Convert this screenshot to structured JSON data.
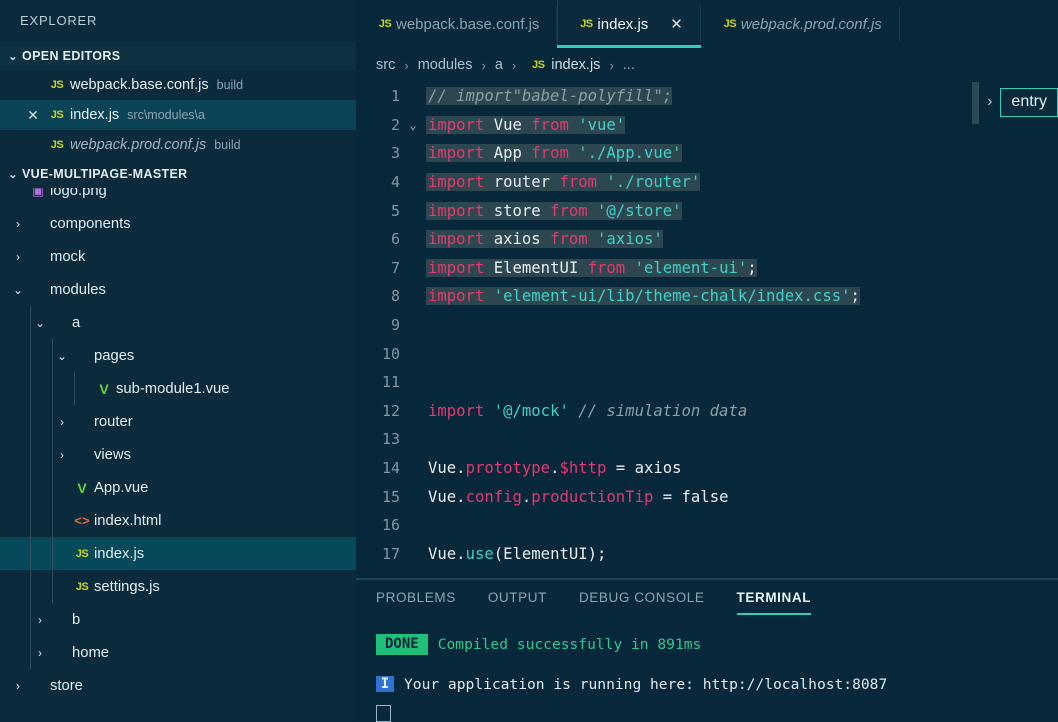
{
  "sidebar": {
    "title": "EXPLORER",
    "open_editors": {
      "label": "OPEN EDITORS",
      "twisty": "⌄",
      "items": [
        {
          "close": "",
          "icon": "js-icon",
          "icon_text": "JS",
          "name": "webpack.base.conf.js",
          "desc": "build",
          "active": false,
          "italic": false
        },
        {
          "close": "✕",
          "icon": "js-icon",
          "icon_text": "JS",
          "name": "index.js",
          "desc": "src\\modules\\a",
          "active": true,
          "italic": false
        },
        {
          "close": "",
          "icon": "js-icon",
          "icon_text": "JS",
          "name": "webpack.prod.conf.js",
          "desc": "build",
          "active": false,
          "italic": true
        }
      ]
    },
    "project": {
      "label": "VUE-MULTIPAGE-MASTER",
      "twisty": "⌄"
    },
    "tree": [
      {
        "label": "logo.png",
        "arrow": "",
        "icon": "image-icon",
        "icon_text": "▣",
        "icon_class": "icon-png",
        "indent": 1,
        "active": false,
        "clipped": true
      },
      {
        "label": "components",
        "arrow": "›",
        "icon": "folder-icon",
        "icon_text": "",
        "icon_class": "",
        "indent": 1,
        "active": false
      },
      {
        "label": "mock",
        "arrow": "›",
        "icon": "folder-icon",
        "icon_text": "",
        "icon_class": "",
        "indent": 1,
        "active": false
      },
      {
        "label": "modules",
        "arrow": "⌄",
        "icon": "folder-icon",
        "icon_text": "",
        "icon_class": "",
        "indent": 1,
        "active": false
      },
      {
        "label": "a",
        "arrow": "⌄",
        "icon": "folder-icon",
        "icon_text": "",
        "icon_class": "",
        "indent": 2,
        "active": false
      },
      {
        "label": "pages",
        "arrow": "⌄",
        "icon": "folder-icon",
        "icon_text": "",
        "icon_class": "",
        "indent": 3,
        "active": false
      },
      {
        "label": "sub-module1.vue",
        "arrow": "",
        "icon": "vue-icon",
        "icon_text": "V",
        "icon_class": "icon-vue",
        "indent": 4,
        "active": false
      },
      {
        "label": "router",
        "arrow": "›",
        "icon": "folder-icon",
        "icon_text": "",
        "icon_class": "",
        "indent": 3,
        "active": false
      },
      {
        "label": "views",
        "arrow": "›",
        "icon": "folder-icon",
        "icon_text": "",
        "icon_class": "",
        "indent": 3,
        "active": false
      },
      {
        "label": "App.vue",
        "arrow": "",
        "icon": "vue-icon",
        "icon_text": "V",
        "icon_class": "icon-vue",
        "indent": 3,
        "active": false
      },
      {
        "label": "index.html",
        "arrow": "",
        "icon": "html-icon",
        "icon_text": "<>",
        "icon_class": "icon-html",
        "indent": 3,
        "active": false
      },
      {
        "label": "index.js",
        "arrow": "",
        "icon": "js-icon",
        "icon_text": "JS",
        "icon_class": "icon-js",
        "indent": 3,
        "active": true
      },
      {
        "label": "settings.js",
        "arrow": "",
        "icon": "js-icon",
        "icon_text": "JS",
        "icon_class": "icon-js",
        "indent": 3,
        "active": false
      },
      {
        "label": "b",
        "arrow": "›",
        "icon": "folder-icon",
        "icon_text": "",
        "icon_class": "",
        "indent": 2,
        "active": false
      },
      {
        "label": "home",
        "arrow": "›",
        "icon": "folder-icon",
        "icon_text": "",
        "icon_class": "",
        "indent": 2,
        "active": false
      },
      {
        "label": "store",
        "arrow": "›",
        "icon": "folder-icon",
        "icon_text": "",
        "icon_class": "",
        "indent": 1,
        "active": false
      }
    ]
  },
  "tabs": [
    {
      "icon_text": "JS",
      "name": "webpack.base.conf.js",
      "active": false,
      "italic": false,
      "close": ""
    },
    {
      "icon_text": "JS",
      "name": "index.js",
      "active": true,
      "italic": false,
      "close": "✕"
    },
    {
      "icon_text": "JS",
      "name": "webpack.prod.conf.js",
      "active": false,
      "italic": true,
      "close": ""
    }
  ],
  "breadcrumb": {
    "items": [
      "src",
      "modules",
      "a"
    ],
    "file_icon": "JS",
    "file": "index.js",
    "dots": "...",
    "separator": "›"
  },
  "sticky": {
    "chevron": "›",
    "label": "entry"
  },
  "code": {
    "lines": [
      {
        "n": "1",
        "fold": "",
        "selected": true,
        "tokens": [
          {
            "t": "// import\"babel-polyfill\";",
            "c": "c-comment"
          }
        ]
      },
      {
        "n": "2",
        "fold": "⌄",
        "selected": true,
        "tokens": [
          {
            "t": "import",
            "c": "c-kw"
          },
          {
            "t": " ",
            "c": "c-plain"
          },
          {
            "t": "Vue",
            "c": "c-var"
          },
          {
            "t": " ",
            "c": "c-plain"
          },
          {
            "t": "from",
            "c": "c-kw"
          },
          {
            "t": " ",
            "c": "c-plain"
          },
          {
            "t": "'vue'",
            "c": "c-str"
          }
        ]
      },
      {
        "n": "3",
        "fold": "",
        "selected": true,
        "tokens": [
          {
            "t": "import",
            "c": "c-kw"
          },
          {
            "t": " ",
            "c": "c-plain"
          },
          {
            "t": "App",
            "c": "c-var"
          },
          {
            "t": " ",
            "c": "c-plain"
          },
          {
            "t": "from",
            "c": "c-kw"
          },
          {
            "t": " ",
            "c": "c-plain"
          },
          {
            "t": "'./App.vue'",
            "c": "c-str"
          }
        ]
      },
      {
        "n": "4",
        "fold": "",
        "selected": true,
        "tokens": [
          {
            "t": "import",
            "c": "c-kw"
          },
          {
            "t": " ",
            "c": "c-plain"
          },
          {
            "t": "router",
            "c": "c-var"
          },
          {
            "t": " ",
            "c": "c-plain"
          },
          {
            "t": "from",
            "c": "c-kw"
          },
          {
            "t": " ",
            "c": "c-plain"
          },
          {
            "t": "'./router'",
            "c": "c-str"
          }
        ]
      },
      {
        "n": "5",
        "fold": "",
        "selected": true,
        "tokens": [
          {
            "t": "import",
            "c": "c-kw"
          },
          {
            "t": " ",
            "c": "c-plain"
          },
          {
            "t": "store",
            "c": "c-var"
          },
          {
            "t": " ",
            "c": "c-plain"
          },
          {
            "t": "from",
            "c": "c-kw"
          },
          {
            "t": " ",
            "c": "c-plain"
          },
          {
            "t": "'@/store'",
            "c": "c-str"
          }
        ]
      },
      {
        "n": "6",
        "fold": "",
        "selected": true,
        "tokens": [
          {
            "t": "import",
            "c": "c-kw"
          },
          {
            "t": " ",
            "c": "c-plain"
          },
          {
            "t": "axios",
            "c": "c-var"
          },
          {
            "t": " ",
            "c": "c-plain"
          },
          {
            "t": "from",
            "c": "c-kw"
          },
          {
            "t": " ",
            "c": "c-plain"
          },
          {
            "t": "'axios'",
            "c": "c-str"
          }
        ]
      },
      {
        "n": "7",
        "fold": "",
        "selected": true,
        "tokens": [
          {
            "t": "import",
            "c": "c-kw"
          },
          {
            "t": " ",
            "c": "c-plain"
          },
          {
            "t": "ElementUI",
            "c": "c-var"
          },
          {
            "t": " ",
            "c": "c-plain"
          },
          {
            "t": "from",
            "c": "c-kw"
          },
          {
            "t": " ",
            "c": "c-plain"
          },
          {
            "t": "'element-ui'",
            "c": "c-str"
          },
          {
            "t": ";",
            "c": "c-plain"
          }
        ]
      },
      {
        "n": "8",
        "fold": "",
        "selected": true,
        "tokens": [
          {
            "t": "import",
            "c": "c-kw"
          },
          {
            "t": " ",
            "c": "c-plain"
          },
          {
            "t": "'element-ui/lib/theme-chalk/index.css'",
            "c": "c-str"
          },
          {
            "t": ";",
            "c": "c-plain"
          }
        ]
      },
      {
        "n": "9",
        "fold": "",
        "selected": false,
        "tokens": []
      },
      {
        "n": "10",
        "fold": "",
        "selected": false,
        "tokens": []
      },
      {
        "n": "11",
        "fold": "",
        "selected": false,
        "tokens": []
      },
      {
        "n": "12",
        "fold": "",
        "selected": false,
        "tokens": [
          {
            "t": "import",
            "c": "c-kw"
          },
          {
            "t": " ",
            "c": "c-plain"
          },
          {
            "t": "'@/mock'",
            "c": "c-str"
          },
          {
            "t": " ",
            "c": "c-plain"
          },
          {
            "t": "// simulation data",
            "c": "c-comment"
          }
        ]
      },
      {
        "n": "13",
        "fold": "",
        "selected": false,
        "tokens": []
      },
      {
        "n": "14",
        "fold": "",
        "selected": false,
        "tokens": [
          {
            "t": "Vue",
            "c": "c-var"
          },
          {
            "t": ".",
            "c": "c-plain"
          },
          {
            "t": "prototype",
            "c": "c-prop"
          },
          {
            "t": ".",
            "c": "c-plain"
          },
          {
            "t": "$http",
            "c": "c-prop"
          },
          {
            "t": " = ",
            "c": "c-plain"
          },
          {
            "t": "axios",
            "c": "c-var"
          }
        ]
      },
      {
        "n": "15",
        "fold": "",
        "selected": false,
        "tokens": [
          {
            "t": "Vue",
            "c": "c-var"
          },
          {
            "t": ".",
            "c": "c-plain"
          },
          {
            "t": "config",
            "c": "c-prop"
          },
          {
            "t": ".",
            "c": "c-plain"
          },
          {
            "t": "productionTip",
            "c": "c-prop"
          },
          {
            "t": " = ",
            "c": "c-plain"
          },
          {
            "t": "false",
            "c": "c-var"
          }
        ]
      },
      {
        "n": "16",
        "fold": "",
        "selected": false,
        "tokens": []
      },
      {
        "n": "17",
        "fold": "",
        "selected": false,
        "tokens": [
          {
            "t": "Vue",
            "c": "c-var"
          },
          {
            "t": ".",
            "c": "c-plain"
          },
          {
            "t": "use",
            "c": "c-fn"
          },
          {
            "t": "(ElementUI);",
            "c": "c-plain"
          }
        ]
      }
    ]
  },
  "panel": {
    "tabs": [
      {
        "label": "PROBLEMS",
        "active": false
      },
      {
        "label": "OUTPUT",
        "active": false
      },
      {
        "label": "DEBUG CONSOLE",
        "active": false
      },
      {
        "label": "TERMINAL",
        "active": true
      }
    ],
    "terminal": {
      "done_badge": "DONE",
      "done_text": "Compiled successfully in 891ms",
      "info_badge": "I",
      "info_text": "Your application is running here: http://localhost:8087"
    }
  },
  "colors": {
    "accent": "#2fd0b5",
    "keyword": "#e8376f",
    "string": "#3fd0c9",
    "comment": "#8d9ea6",
    "success": "#21c07a",
    "info": "#2f72d0",
    "sidebar_bg": "#0b2b3c",
    "editor_bg": "#07283a",
    "active_row": "#05495b"
  }
}
